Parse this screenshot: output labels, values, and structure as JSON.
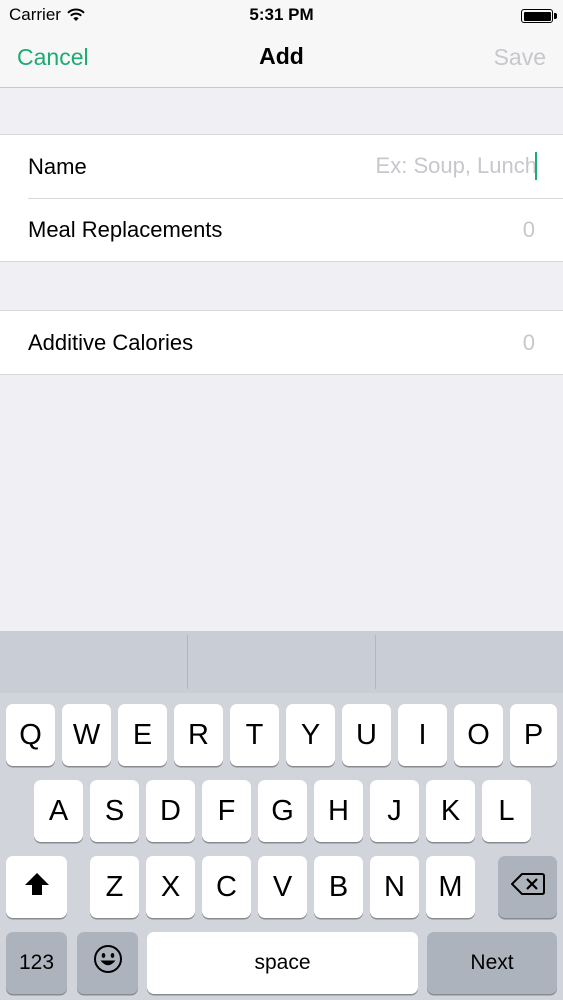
{
  "status_bar": {
    "carrier": "Carrier",
    "time": "5:31 PM",
    "wifi_icon": "wifi-icon",
    "battery_icon": "battery-icon"
  },
  "nav": {
    "cancel_label": "Cancel",
    "title": "Add",
    "save_label": "Save"
  },
  "form": {
    "name": {
      "label": "Name",
      "value": "",
      "placeholder": "Ex: Soup, Lunch"
    },
    "meal_replacements": {
      "label": "Meal Replacements",
      "value": "0"
    },
    "additive_calories": {
      "label": "Additive Calories",
      "value": "0"
    }
  },
  "keyboard": {
    "row1": [
      "Q",
      "W",
      "E",
      "R",
      "T",
      "Y",
      "U",
      "I",
      "O",
      "P"
    ],
    "row2": [
      "A",
      "S",
      "D",
      "F",
      "G",
      "H",
      "J",
      "K",
      "L"
    ],
    "row3": [
      "Z",
      "X",
      "C",
      "V",
      "B",
      "N",
      "M"
    ],
    "numbers_label": "123",
    "space_label": "space",
    "return_label": "Next",
    "shift_icon": "shift-icon",
    "delete_icon": "delete-icon",
    "emoji_icon": "emoji-icon"
  },
  "colors": {
    "accent": "#1cab72",
    "placeholder": "#c7c7cc",
    "background": "#efeff4"
  }
}
